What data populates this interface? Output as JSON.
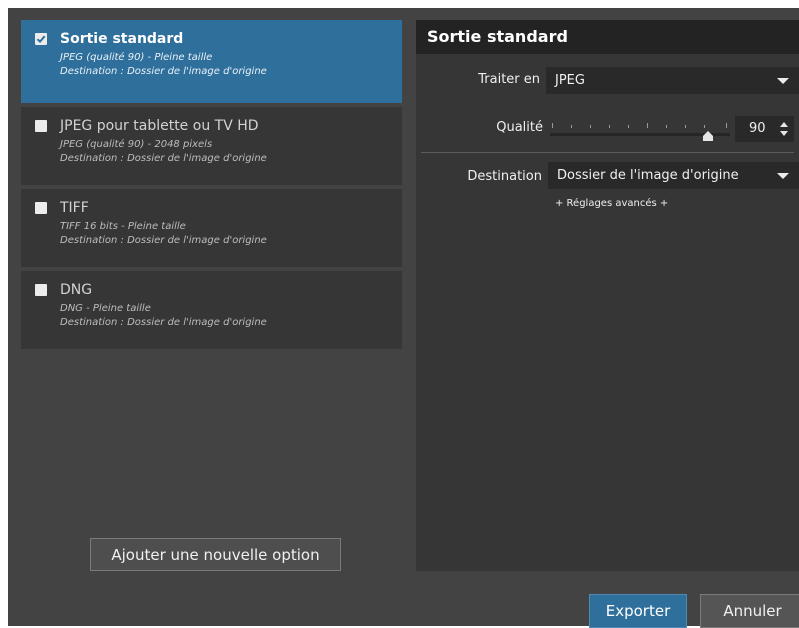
{
  "presets": [
    {
      "name": "Sortie standard",
      "line1": "JPEG (qualité 90)  -  Pleine taille",
      "line2": "Destination : Dossier de l'image d'origine",
      "checked": true
    },
    {
      "name": "JPEG pour tablette ou TV HD",
      "line1": "JPEG (qualité 90)  -  2048 pixels",
      "line2": "Destination : Dossier de l'image d'origine",
      "checked": false
    },
    {
      "name": "TIFF",
      "line1": "TIFF 16 bits  -  Pleine taille",
      "line2": "Destination : Dossier de l'image d'origine",
      "checked": false
    },
    {
      "name": "DNG",
      "line1": "DNG  -  Pleine taille",
      "line2": "Destination : Dossier de l'image d'origine",
      "checked": false
    }
  ],
  "add_option_label": "Ajouter une nouvelle option",
  "settings": {
    "title": "Sortie standard",
    "process_label": "Traiter en",
    "process_value": "JPEG",
    "quality_label": "Qualité",
    "quality_value": "90",
    "quality_fraction": 0.9,
    "destination_label": "Destination",
    "destination_value": "Dossier de l'image d'origine",
    "advanced_link": "+ Réglages avancés +"
  },
  "buttons": {
    "export": "Exporter",
    "cancel": "Annuler"
  },
  "colors": {
    "accent": "#2f6f9c",
    "panel": "#363636",
    "background": "#434343"
  },
  "icons": {
    "checkbox": "checkbox-icon",
    "dropdown": "chevron-down-icon",
    "slider": "slider-thumb-icon",
    "spinner": "spinner-arrows-icon"
  }
}
